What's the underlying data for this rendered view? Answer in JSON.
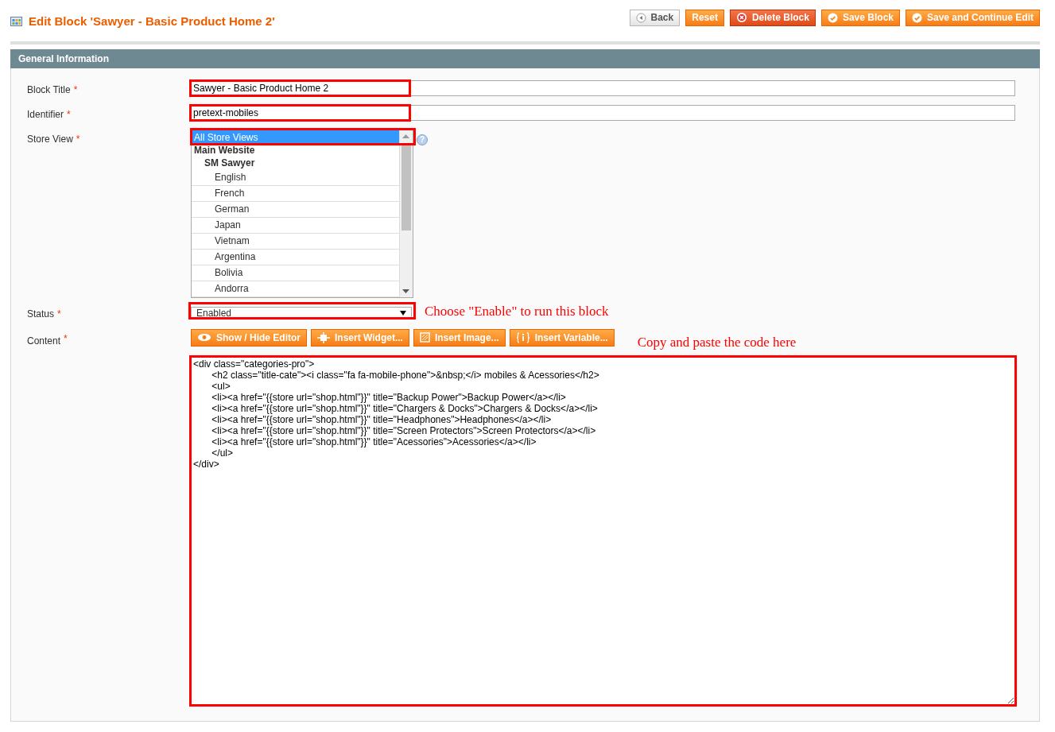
{
  "page_title": "Edit Block 'Sawyer - Basic Product Home 2'",
  "buttons": [
    {
      "label": "Back",
      "kind": "back"
    },
    {
      "label": "Reset",
      "kind": "plain"
    },
    {
      "label": "Delete Block",
      "kind": "delete"
    },
    {
      "label": "Save Block",
      "kind": "save"
    },
    {
      "label": "Save and Continue Edit",
      "kind": "save"
    }
  ],
  "section": {
    "title": "General Information"
  },
  "fields": [
    {
      "kind": "text",
      "label": "Block Title",
      "required_mark": "*",
      "value": "Sawyer - Basic Product Home 2",
      "highlighted": true
    },
    {
      "kind": "text",
      "label": "Identifier",
      "required_mark": "*",
      "value": "pretext-mobiles",
      "highlighted": true
    },
    {
      "kind": "multiselect",
      "label": "Store View",
      "required_mark": "*",
      "help": "?",
      "highlighted": true,
      "options": [
        {
          "label": "All Store Views",
          "selected": true
        },
        {
          "label": "Main Website",
          "selected": false,
          "children": [
            {
              "label": "SM Sawyer",
              "selected": false,
              "children": [
                {
                  "label": "English",
                  "selected": false
                },
                {
                  "label": "French",
                  "selected": false
                },
                {
                  "label": "German",
                  "selected": false
                },
                {
                  "label": "Japan",
                  "selected": false
                },
                {
                  "label": "Vietnam",
                  "selected": false
                },
                {
                  "label": "Argentina",
                  "selected": false
                },
                {
                  "label": "Bolivia",
                  "selected": false
                },
                {
                  "label": "Andorra",
                  "selected": false
                }
              ]
            }
          ]
        }
      ]
    },
    {
      "kind": "select",
      "label": "Status",
      "required_mark": "*",
      "value": "Enabled",
      "highlighted": true,
      "note": "Choose \"Enable\" to run this block"
    },
    {
      "kind": "editor",
      "label": "Content",
      "required_mark": "*",
      "highlighted": true,
      "note": "Copy and paste the code here",
      "tools": [
        {
          "label": "Show / Hide Editor"
        },
        {
          "label": "Insert Widget..."
        },
        {
          "label": "Insert Image..."
        },
        {
          "label": "Insert Variable..."
        }
      ],
      "value": "<div class=\"categories-pro\">\n\t<h2 class=\"title-cate\"><i class=\"fa fa-mobile-phone\">&nbsp;</i> mobiles & Acessories</h2>\n\t<ul>\n\t<li><a href=\"{{store url=\"shop.html\"}}\" title=\"Backup Power\">Backup Power</a></li>\n\t<li><a href=\"{{store url=\"shop.html\"}}\" title=\"Chargers & Docks\">Chargers & Docks</a></li>\n\t<li><a href=\"{{store url=\"shop.html\"}}\" title=\"Headphones\">Headphones</a></li>\n\t<li><a href=\"{{store url=\"shop.html\"}}\" title=\"Screen Protectors\">Screen Protectors</a></li>\n\t<li><a href=\"{{store url=\"shop.html\"}}\" title=\"Acessories\">Acessories</a></li>\n\t</ul>\n</div>"
    }
  ]
}
